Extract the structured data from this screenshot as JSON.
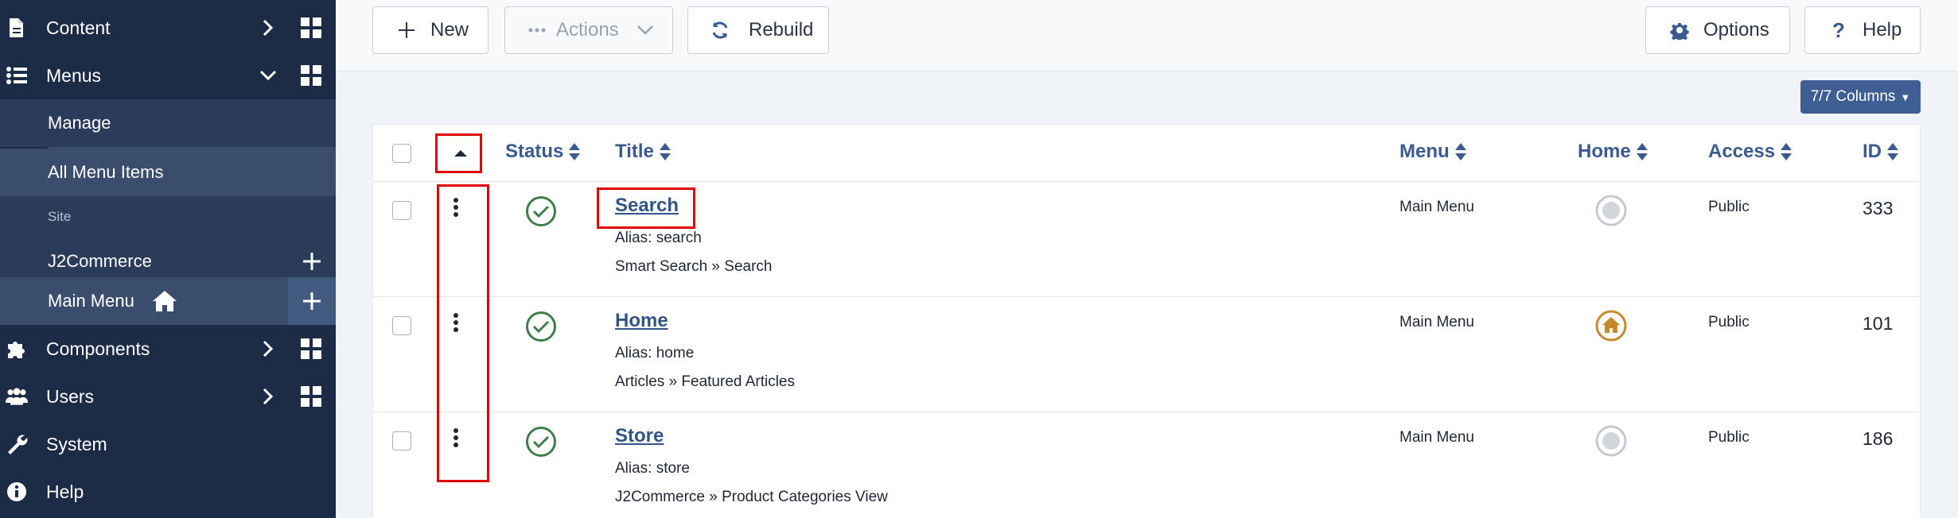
{
  "sidebar": {
    "content": "Content",
    "menus": "Menus",
    "manage": "Manage",
    "all_menu_items": "All Menu Items",
    "site_section": "Site",
    "j2commerce": "J2Commerce",
    "main_menu": "Main Menu",
    "components": "Components",
    "users": "Users",
    "system": "System",
    "help": "Help"
  },
  "toolbar": {
    "new_label": "New",
    "actions_label": "Actions",
    "rebuild_label": "Rebuild",
    "options_label": "Options",
    "help_label": "Help"
  },
  "columns_button": "7/7 Columns",
  "table": {
    "headers": {
      "status": "Status",
      "title": "Title",
      "menu": "Menu",
      "home": "Home",
      "access": "Access",
      "id": "ID"
    },
    "rows": [
      {
        "title": "Search",
        "alias": "Alias: search",
        "type": "Smart Search » Search",
        "menu": "Main Menu",
        "home": false,
        "access": "Public",
        "id": "333"
      },
      {
        "title": "Home",
        "alias": "Alias: home",
        "type": "Articles » Featured Articles",
        "menu": "Main Menu",
        "home": true,
        "access": "Public",
        "id": "101"
      },
      {
        "title": "Store",
        "alias": "Alias: store",
        "type": "J2Commerce » Product Categories View",
        "menu": "Main Menu",
        "home": false,
        "access": "Public",
        "id": "186"
      }
    ]
  },
  "colors": {
    "sidebar_bg": "#1c2c47",
    "accent": "#3b5a8e",
    "status_green": "#3f7d4b",
    "home_gold": "#c58a2d",
    "highlight_red": "#e00000"
  }
}
